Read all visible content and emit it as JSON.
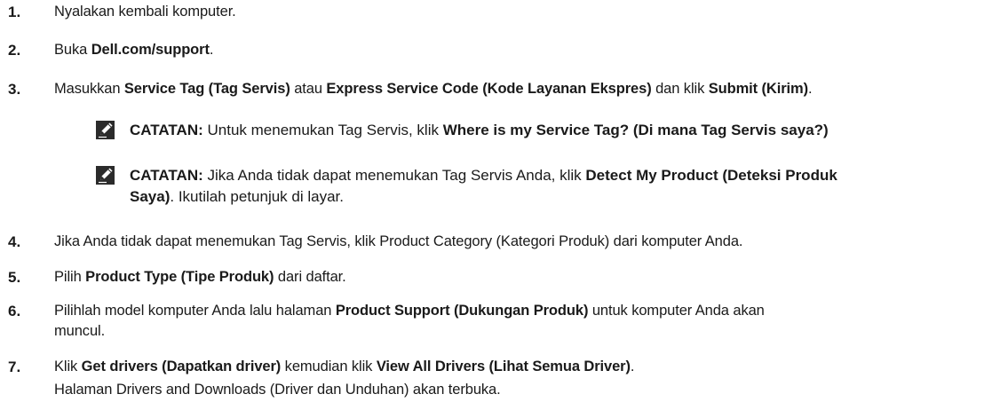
{
  "steps": [
    {
      "num": "1.",
      "parts": [
        {
          "t": "Nyalakan kembali komputer.",
          "b": false
        }
      ]
    },
    {
      "num": "2.",
      "parts": [
        {
          "t": "Buka ",
          "b": false
        },
        {
          "t": "Dell.com/support",
          "b": true
        },
        {
          "t": ".",
          "b": false
        }
      ]
    },
    {
      "num": "3.",
      "parts": [
        {
          "t": "Masukkan ",
          "b": false
        },
        {
          "t": "Service Tag (Tag Servis)",
          "b": true
        },
        {
          "t": " atau ",
          "b": false
        },
        {
          "t": "Express Service Code (Kode Layanan Ekspres)",
          "b": true
        },
        {
          "t": " dan klik ",
          "b": false
        },
        {
          "t": "Submit (Kirim)",
          "b": true
        },
        {
          "t": ".",
          "b": false
        }
      ]
    },
    {
      "num": "4.",
      "parts": [
        {
          "t": "Jika Anda tidak dapat menemukan Tag Servis, klik Product Category (Kategori Produk) dari komputer Anda.",
          "b": false
        }
      ]
    },
    {
      "num": "5.",
      "parts": [
        {
          "t": "Pilih ",
          "b": false
        },
        {
          "t": "Product Type (Tipe Produk)",
          "b": true
        },
        {
          "t": " dari daftar.",
          "b": false
        }
      ]
    },
    {
      "num": "6.",
      "parts": [
        {
          "t": "Pilihlah model komputer Anda lalu halaman ",
          "b": false
        },
        {
          "t": "Product Support (Dukungan Produk)",
          "b": true
        },
        {
          "t": " untuk komputer Anda akan",
          "b": false
        }
      ],
      "cont": "muncul."
    },
    {
      "num": "7.",
      "parts": [
        {
          "t": "Klik ",
          "b": false
        },
        {
          "t": "Get drivers (Dapatkan driver)",
          "b": true
        },
        {
          "t": " kemudian klik ",
          "b": false
        },
        {
          "t": "View All Drivers (Lihat Semua Driver)",
          "b": true
        },
        {
          "t": ".",
          "b": false
        }
      ],
      "cont": "Halaman Drivers and Downloads (Driver dan Unduhan) akan terbuka."
    }
  ],
  "notes": [
    {
      "parts": [
        {
          "t": "CATATAN:",
          "b": true
        },
        {
          "t": " Untuk menemukan Tag Servis, klik ",
          "b": false
        },
        {
          "t": "Where is my Service Tag? (Di mana Tag Servis saya?)",
          "b": true
        }
      ]
    },
    {
      "parts": [
        {
          "t": "CATATAN:",
          "b": true
        },
        {
          "t": " Jika Anda tidak dapat menemukan Tag Servis Anda, klik ",
          "b": false
        },
        {
          "t": "Detect My Product (Deteksi Produk",
          "b": true
        }
      ],
      "line2": [
        {
          "t": "Saya)",
          "b": true
        },
        {
          "t": ". Ikutilah petunjuk di layar.",
          "b": false
        }
      ]
    }
  ],
  "icons": {
    "note": "pencil-note-icon"
  }
}
